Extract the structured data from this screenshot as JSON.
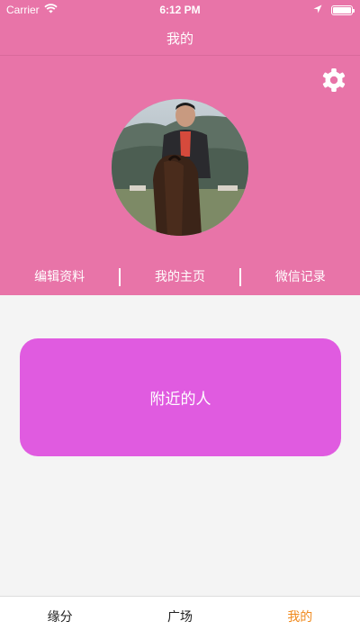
{
  "status_bar": {
    "carrier": "Carrier",
    "time": "6:12 PM",
    "battery_level": 1.0
  },
  "nav": {
    "title": "我的"
  },
  "profile": {
    "links": [
      "编辑资料",
      "我的主页",
      "微信记录"
    ]
  },
  "nearby": {
    "label": "附近的人"
  },
  "tabs": [
    {
      "label": "缘分",
      "active": false
    },
    {
      "label": "广场",
      "active": false
    },
    {
      "label": "我的",
      "active": true
    }
  ],
  "colors": {
    "header_pink": "#e874a8",
    "card_magenta": "#e05be0",
    "active_tab": "#f08a1e",
    "background": "#f4f4f4"
  },
  "icons": [
    "wifi-icon",
    "location-arrow-icon",
    "battery-icon",
    "gear-icon"
  ]
}
